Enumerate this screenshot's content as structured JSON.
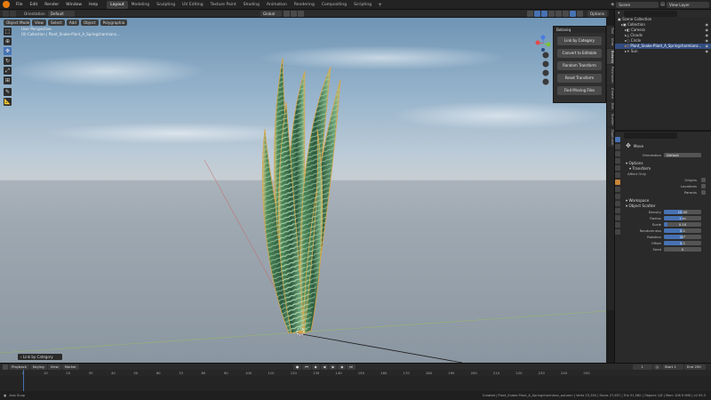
{
  "topbar": {
    "menus": [
      "File",
      "Edit",
      "Render",
      "Window",
      "Help"
    ],
    "workspaces": [
      "Layout",
      "Modeling",
      "Sculpting",
      "UV Editing",
      "Texture Paint",
      "Shading",
      "Animation",
      "Rendering",
      "Compositing",
      "Scripting"
    ],
    "active_workspace": "Layout",
    "scene": "Scene",
    "view_layer": "View Layer"
  },
  "viewport_header": {
    "orientation_label": "Orientation",
    "orientation_value": "Default",
    "mode": "Object Mode",
    "menus": [
      "View",
      "Select",
      "Add",
      "Object",
      "Polygraphia"
    ],
    "transform": "Global",
    "options": "Options"
  },
  "viewport": {
    "perspective": "User Perspective",
    "collection_info": "(0) Collection | Plant_Snake-Plant_A_Springcharmianz..."
  },
  "npanel": {
    "title": "Botaniq",
    "buttons": [
      "Link by Category",
      "Convert to Editable",
      "Random Transform",
      "Reset Transform",
      "Find Missing Files"
    ]
  },
  "side_tabs": [
    "Tool",
    "View",
    "Botaniq",
    "Polyhaven",
    "Create",
    "Edit",
    "Scatter",
    "Duplicate"
  ],
  "outliner": {
    "items": [
      {
        "label": "Scene Collection",
        "selected": false
      },
      {
        "label": "Collection",
        "selected": false
      },
      {
        "label": "Camera",
        "selected": false
      },
      {
        "label": "Clouds",
        "selected": false
      },
      {
        "label": "Circle",
        "selected": false
      },
      {
        "label": "Plant_Snake-Plant_A_Springcharmianz...",
        "selected": true
      },
      {
        "label": "Sun",
        "selected": false
      }
    ]
  },
  "properties": {
    "tool_name": "Move",
    "orientation_label": "Orientation",
    "orientation_value": "Default",
    "options_label": "Options",
    "transform_label": "Transform",
    "affect_only_label": "Affect Only",
    "affect_items": [
      "Origins",
      "Locations",
      "Parents"
    ],
    "workspace_label": "Workspace",
    "object_scatter_label": "Object Scatter",
    "fields": [
      {
        "label": "Density",
        "value": "10.00",
        "fraction": 0.5
      },
      {
        "label": "Radius",
        "value": "1 m",
        "fraction": 0.5
      },
      {
        "label": "Scale",
        "value": "0.10",
        "fraction": 0.1
      },
      {
        "label": "Randomness",
        "value": "0.1",
        "fraction": 0.5
      },
      {
        "label": "Rotation",
        "value": "20°",
        "fraction": 0.5
      },
      {
        "label": "Offset",
        "value": "0.1",
        "fraction": 0.5
      },
      {
        "label": "Seed",
        "value": "0",
        "fraction": 0.0
      }
    ]
  },
  "timeline": {
    "menus": [
      "Playback",
      "Keying",
      "View",
      "Marker"
    ],
    "current_frame": "1",
    "start_label": "Start",
    "start": "1",
    "end_label": "End",
    "end": "250",
    "ticks": [
      "0",
      "10",
      "20",
      "30",
      "40",
      "50",
      "60",
      "70",
      "80",
      "90",
      "100",
      "110",
      "120",
      "130",
      "140",
      "150",
      "160",
      "170",
      "180",
      "190",
      "200",
      "210",
      "220",
      "230",
      "240",
      "250"
    ]
  },
  "operator_panel": "Link by Category",
  "status": {
    "left": "Axis Snap",
    "right": "Created | Plant_Snake-Plant_A_Springcharmianz_autumn | Verts 23,350 | Faces 27,657 | Tris 51,560 | Objects 1/8 | Mem 106.9 MiB | v2.93.3"
  },
  "colors": {
    "accent": "#4772b3",
    "plant_dark": "#2f5a3c",
    "plant_light": "#8fb98a",
    "plant_edge": "#c9a54a",
    "sky": "#96b3cb",
    "ground": "#9ea8b1"
  }
}
